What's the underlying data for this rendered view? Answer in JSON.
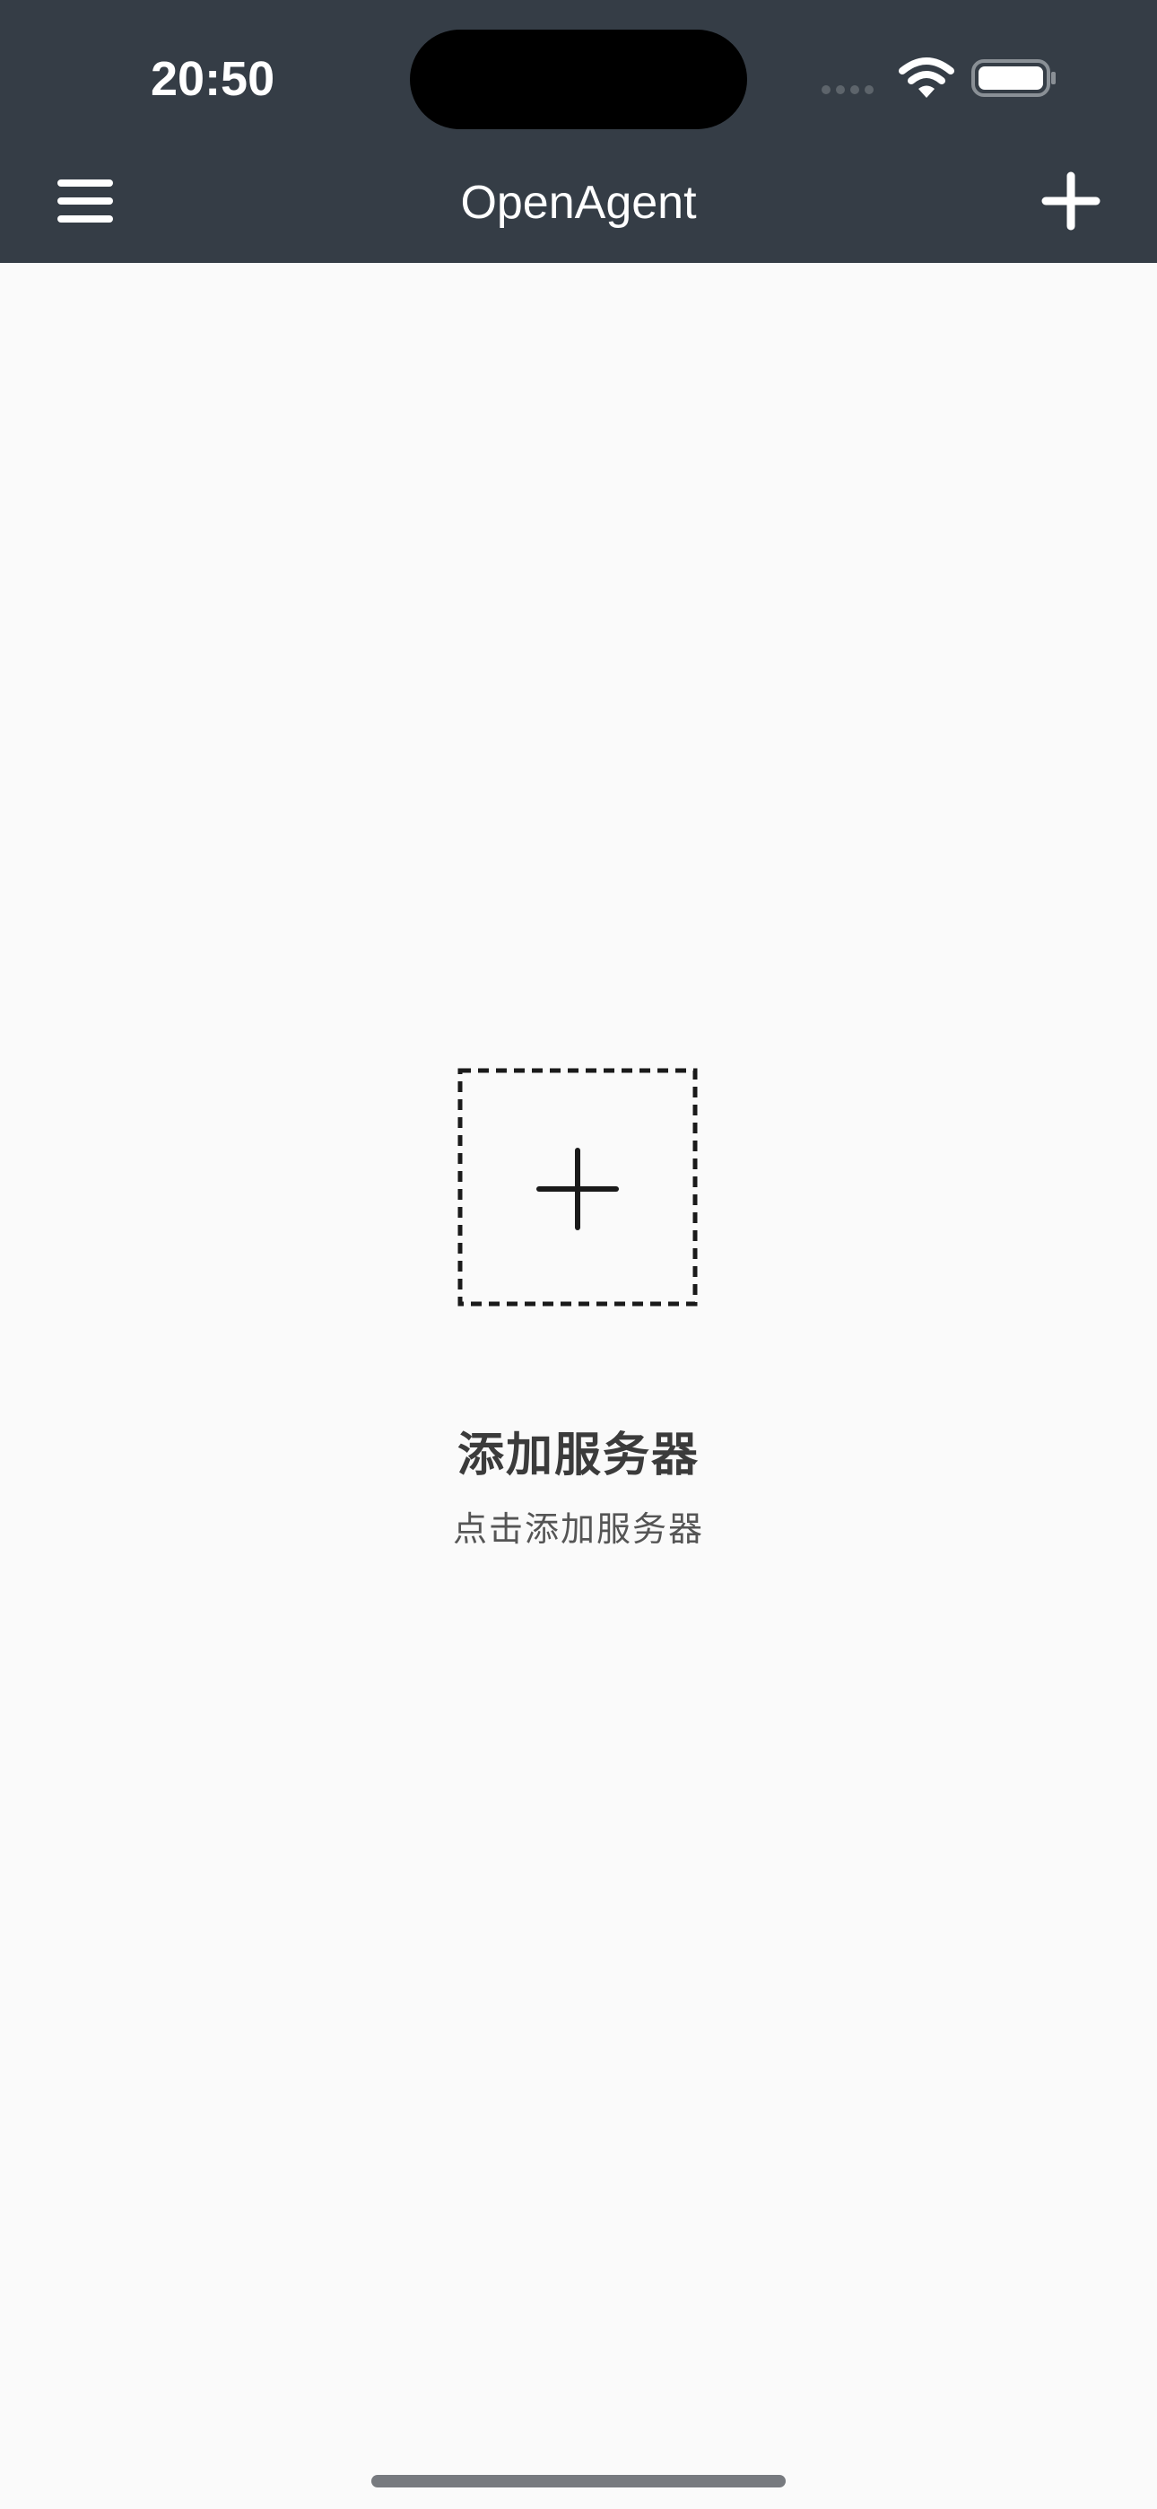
{
  "status_bar": {
    "time": "20:50"
  },
  "app_bar": {
    "title": "OpenAgent",
    "menu_icon": "hamburger-menu-icon",
    "add_icon": "plus-icon"
  },
  "empty_state": {
    "icon": "add-dashed-box-icon",
    "title": "添加服务器",
    "subtitle": "点击添加服务器"
  },
  "colors": {
    "app_bar": "#353d46",
    "background": "#fafafa",
    "text_primary": "#3b3b3b",
    "text_secondary": "#555555"
  }
}
